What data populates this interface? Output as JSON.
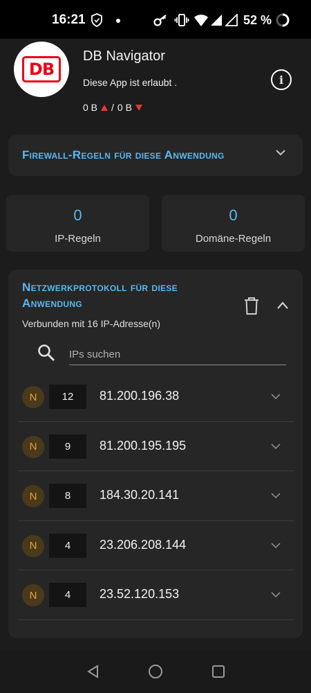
{
  "status_bar": {
    "time": "16:21",
    "battery_pct": "52 %",
    "icons": [
      "shield-icon",
      "dot-icon",
      "key-icon",
      "vibrate-icon",
      "wifi-icon",
      "signal-icon",
      "signal-icon",
      "battery-icon"
    ]
  },
  "app": {
    "logo_text": "DB",
    "name": "DB Navigator",
    "status": "Diese App ist erlaubt .",
    "traffic_up": "0 B",
    "traffic_sep": "/",
    "traffic_down": "0 B",
    "colors": {
      "logo_red": "#ec0016",
      "up_down_arrows": "#e53935"
    }
  },
  "firewall": {
    "title": "Firewall-Regeln für diese Anwendung",
    "expanded": false
  },
  "stats": {
    "ip_rules": {
      "count": "0",
      "label": "IP-Regeln"
    },
    "domain_rules": {
      "count": "0",
      "label": "Domäne-Regeln"
    }
  },
  "log": {
    "title": "Netzwerkprotokoll für diese Anwendung",
    "subtitle": "Verbunden mit 16 IP-Adresse(n)",
    "search_placeholder": "IPs suchen",
    "expanded": true,
    "rows": [
      {
        "badge": "N",
        "count": "12",
        "ip": "81.200.196.38"
      },
      {
        "badge": "N",
        "count": "9",
        "ip": "81.200.195.195"
      },
      {
        "badge": "N",
        "count": "8",
        "ip": "184.30.20.141"
      },
      {
        "badge": "N",
        "count": "4",
        "ip": "23.206.208.144"
      },
      {
        "badge": "N",
        "count": "4",
        "ip": "23.52.120.153"
      }
    ]
  },
  "theme": {
    "accent": "#5bb7f0",
    "card": "#262626",
    "background": "#1c1c1c",
    "badge_bg": "#4a3a1a",
    "badge_fg": "#e0a43c"
  }
}
